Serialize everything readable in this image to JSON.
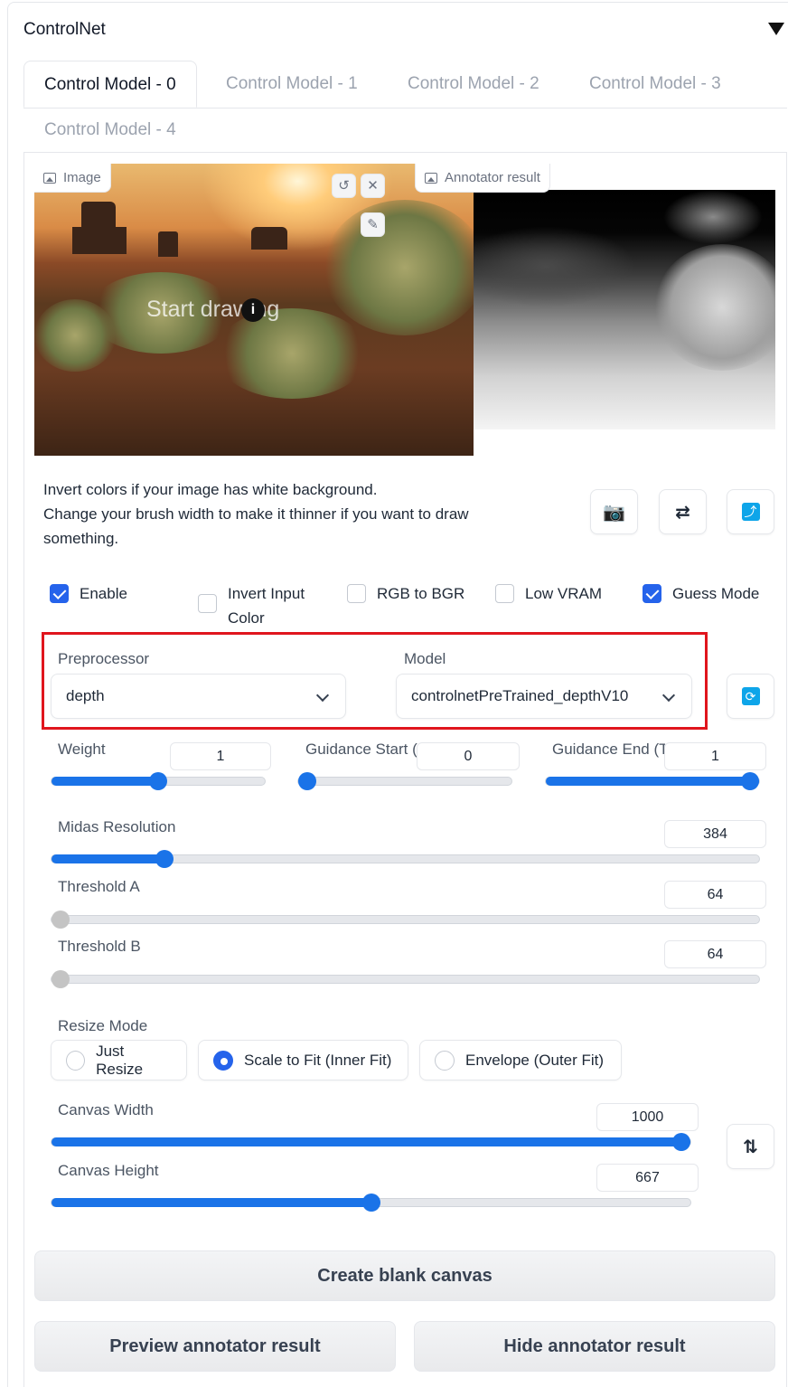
{
  "header": {
    "title": "ControlNet"
  },
  "tabs": [
    {
      "label": "Control Model - 0"
    },
    {
      "label": "Control Model - 1"
    },
    {
      "label": "Control Model - 2"
    },
    {
      "label": "Control Model - 3"
    },
    {
      "label": "Control Model - 4"
    }
  ],
  "image_panel": {
    "label": "Image",
    "overlay_text": "Start drawing"
  },
  "annotator_panel": {
    "label": "Annotator result"
  },
  "help_text": {
    "line1": "Invert colors if your image has white background.",
    "line2": "Change your brush width to make it thinner if you want to draw something."
  },
  "icon_buttons": [
    "camera-icon",
    "swap-icon",
    "send-icon"
  ],
  "checkboxes": [
    {
      "label": "Enable",
      "checked": true
    },
    {
      "label": "Invert Input Color",
      "checked": false
    },
    {
      "label": "RGB to BGR",
      "checked": false
    },
    {
      "label": "Low VRAM",
      "checked": false
    },
    {
      "label": "Guess Mode",
      "checked": true
    }
  ],
  "preprocessor": {
    "label": "Preprocessor",
    "value": "depth"
  },
  "model": {
    "label": "Model",
    "value": "controlnetPreTrained_depthV10"
  },
  "sliders": {
    "weight": {
      "label": "Weight",
      "value": "1",
      "fraction": 0.5
    },
    "guidance_start": {
      "label": "Guidance Start (T)",
      "value": "0",
      "fraction": 0.0
    },
    "guidance_end": {
      "label": "Guidance End (T)",
      "value": "1",
      "fraction": 1.0
    },
    "midas_resolution": {
      "label": "Midas Resolution",
      "value": "384",
      "fraction": 0.16
    },
    "threshold_a": {
      "label": "Threshold A",
      "value": "64",
      "fraction": 0.0
    },
    "threshold_b": {
      "label": "Threshold B",
      "value": "64",
      "fraction": 0.0
    },
    "canvas_width": {
      "label": "Canvas Width",
      "value": "1000",
      "fraction": 1.0
    },
    "canvas_height": {
      "label": "Canvas Height",
      "value": "667",
      "fraction": 0.5
    }
  },
  "resize_mode": {
    "label": "Resize Mode",
    "options": [
      "Just Resize",
      "Scale to Fit (Inner Fit)",
      "Envelope (Outer Fit)"
    ],
    "selected": "Scale to Fit (Inner Fit)"
  },
  "buttons": {
    "create_blank_canvas": "Create blank canvas",
    "preview_annotator": "Preview annotator result",
    "hide_annotator": "Hide annotator result"
  },
  "colors": {
    "accent": "#1a73e8",
    "highlight_border": "#e0151d"
  }
}
